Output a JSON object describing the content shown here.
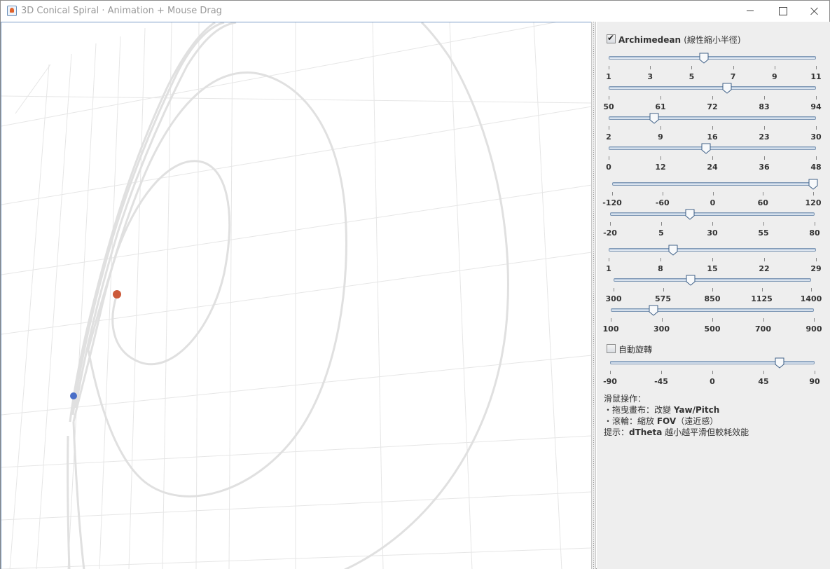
{
  "window": {
    "title": "3D Conical Spiral · Animation + Mouse Drag",
    "icon": "java-cup-icon"
  },
  "panel": {
    "archimedean": {
      "checked": true,
      "label_main": "Archimedean",
      "label_sub": "(線性縮小半徑)"
    },
    "sliders": [
      {
        "ticks": [
          "1",
          "3",
          "5",
          "7",
          "9",
          "11"
        ],
        "value_fraction": 0.46
      },
      {
        "ticks": [
          "50",
          "61",
          "72",
          "83",
          "94"
        ],
        "value_fraction": 0.57
      },
      {
        "ticks": [
          "2",
          "9",
          "16",
          "23",
          "30"
        ],
        "value_fraction": 0.22
      },
      {
        "ticks": [
          "0",
          "12",
          "24",
          "36",
          "48"
        ],
        "value_fraction": 0.47
      },
      {
        "ticks": [
          "-120",
          "-60",
          "0",
          "60",
          "120"
        ],
        "value_fraction": 1.0
      },
      {
        "ticks": [
          "-20",
          "5",
          "30",
          "55",
          "80"
        ],
        "value_fraction": 0.39
      },
      {
        "ticks": [
          "1",
          "8",
          "15",
          "22",
          "29"
        ],
        "value_fraction": 0.31
      },
      {
        "ticks": [
          "300",
          "575",
          "850",
          "1125",
          "1400"
        ],
        "value_fraction": 0.39
      },
      {
        "ticks": [
          "100",
          "300",
          "500",
          "700",
          "900"
        ],
        "value_fraction": 0.21
      }
    ],
    "auto_rotate": {
      "checked": false,
      "label": "自動旋轉"
    },
    "rotation_slider": {
      "ticks": [
        "-90",
        "-45",
        "0",
        "45",
        "90"
      ],
      "value_fraction": 0.83
    },
    "help": {
      "title": "滑鼠操作：",
      "drag_prefix": "・拖曳畫布：改變 ",
      "drag_value": "Yaw/Pitch",
      "wheel_prefix": "・滾輪：縮放 ",
      "wheel_value": "FOV",
      "wheel_suffix": "（遠近感）",
      "tip_prefix": "提示：",
      "tip_value": "dTheta",
      "tip_suffix": " 越小越平滑但較耗效能"
    }
  },
  "colors": {
    "spiral": "#e0e0e0",
    "grid": "#e6e6e6",
    "start_point": "#cc5a3a",
    "end_point": "#4a6fc8",
    "panel_bg": "#eeeeee"
  }
}
